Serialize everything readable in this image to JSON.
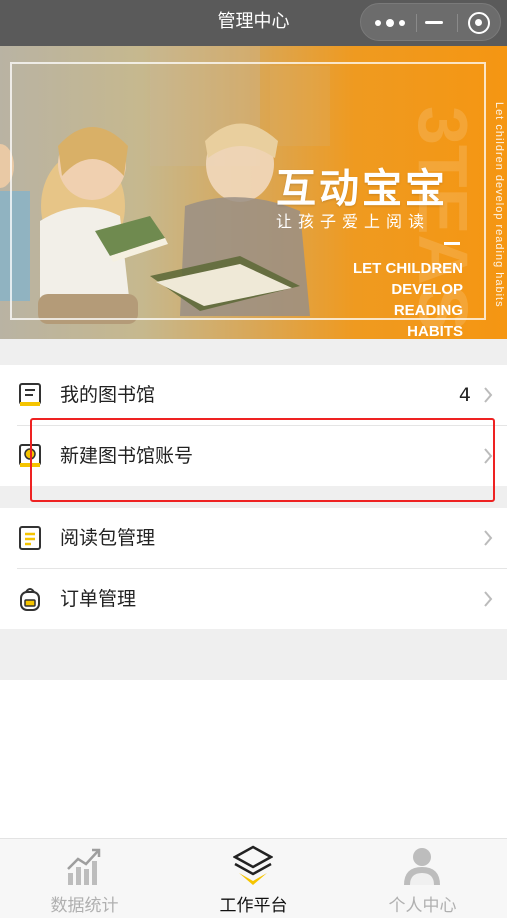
{
  "titlebar": {
    "title": "管理中心",
    "more_icon": "more-dots-icon",
    "minimize_icon": "minimize-icon",
    "close_icon": "target-circle-icon"
  },
  "banner": {
    "title": "互动宝宝",
    "subtitle": "让孩子爱上阅读",
    "english_lines": [
      "LET CHILDREN",
      "DEVELOP",
      "READING",
      "HABITS"
    ],
    "vertical_text": "Let children develop reading habits",
    "watermark": "3TEAS",
    "accent_color": "#f59612"
  },
  "menu": {
    "items": [
      {
        "label": "我的图书馆",
        "count": "4",
        "icon": "book-icon"
      },
      {
        "label": "新建图书馆账号",
        "icon": "book-add-icon"
      },
      {
        "label": "阅读包管理",
        "icon": "list-doc-icon"
      },
      {
        "label": "订单管理",
        "icon": "backpack-icon"
      }
    ],
    "highlight_color": "#ee2222",
    "icon_accent": "#f5c400"
  },
  "tabbar": {
    "tabs": [
      {
        "label": "数据统计",
        "icon": "chart-growth-icon",
        "active": false
      },
      {
        "label": "工作平台",
        "icon": "layers-icon",
        "active": true
      },
      {
        "label": "个人中心",
        "icon": "user-icon",
        "active": false
      }
    ]
  }
}
